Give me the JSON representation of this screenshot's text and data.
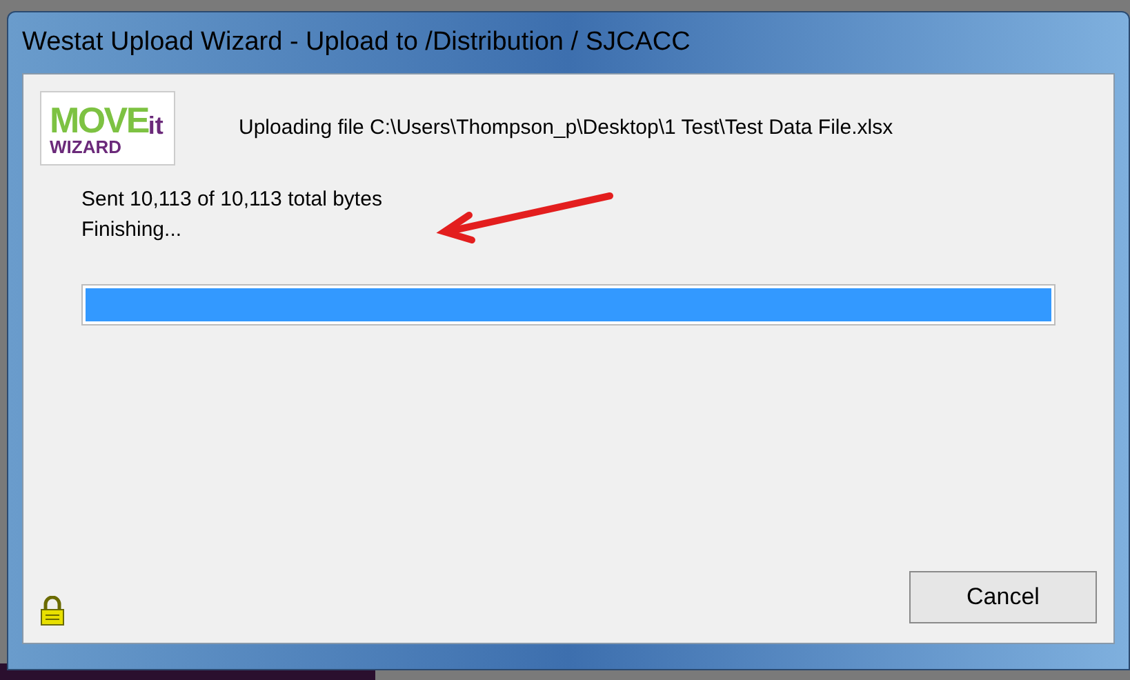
{
  "window": {
    "title": "Westat Upload Wizard - Upload to /Distribution / SJCACC"
  },
  "logo": {
    "word": "MOVE",
    "suffix": "it",
    "subtitle": "WIZARD"
  },
  "file_line": "Uploading file C:\\Users\\Thompson_p\\Desktop\\1 Test\\Test Data File.xlsx",
  "status_lines": [
    "Sent 10,113 of 10,113 total bytes",
    "Finishing..."
  ],
  "progress": {
    "level": 1
  },
  "buttons": [
    {
      "label": "Cancel"
    }
  ]
}
